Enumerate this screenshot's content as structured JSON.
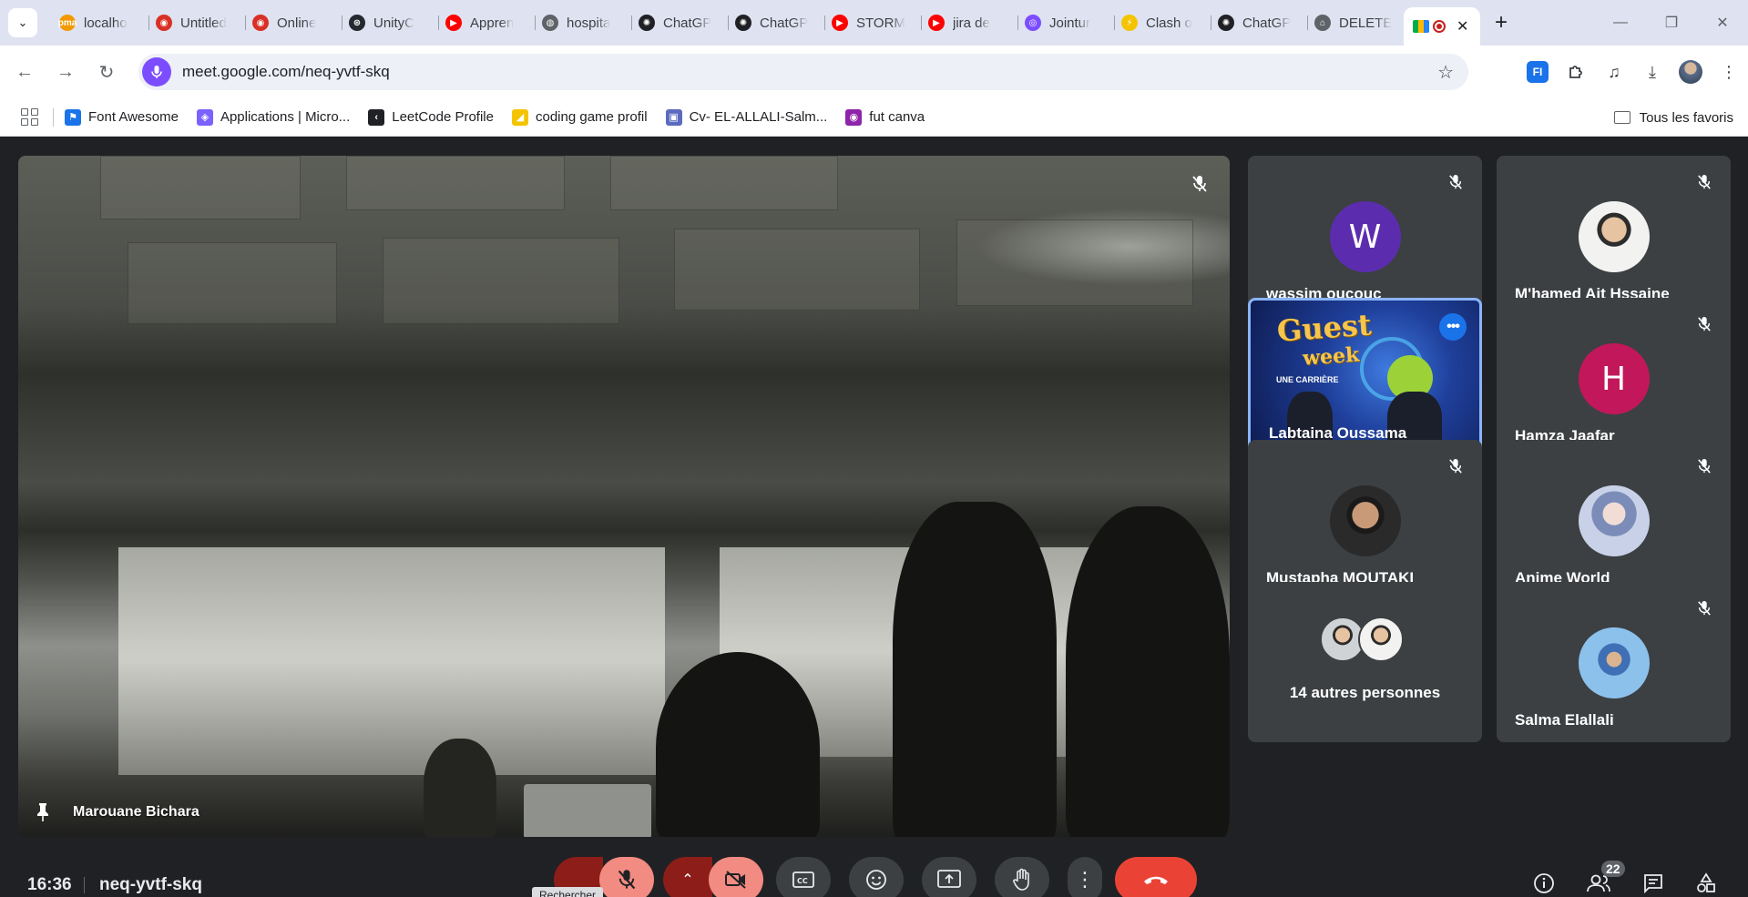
{
  "browser": {
    "tabs": [
      {
        "title": "localho",
        "fav_color": "#f29900",
        "fav_glyph": "pma"
      },
      {
        "title": "Untitled",
        "fav_color": "#d93025",
        "fav_glyph": "◉"
      },
      {
        "title": "Online",
        "fav_color": "#d93025",
        "fav_glyph": "◉"
      },
      {
        "title": "UnityC",
        "fav_color": "#24292f",
        "fav_glyph": "⊛"
      },
      {
        "title": "Appren",
        "fav_color": "#ff0000",
        "fav_glyph": "▶"
      },
      {
        "title": "hospita",
        "fav_color": "#5f6368",
        "fav_glyph": "◍"
      },
      {
        "title": "ChatGP",
        "fav_color": "#202124",
        "fav_glyph": "✺"
      },
      {
        "title": "ChatGP",
        "fav_color": "#202124",
        "fav_glyph": "✺"
      },
      {
        "title": "STORM",
        "fav_color": "#ff0000",
        "fav_glyph": "▶"
      },
      {
        "title": "jira de",
        "fav_color": "#ff0000",
        "fav_glyph": "▶"
      },
      {
        "title": "Jointur",
        "fav_color": "#7c4dff",
        "fav_glyph": "◎"
      },
      {
        "title": "Clash o",
        "fav_color": "#f5c400",
        "fav_glyph": "⚡"
      },
      {
        "title": "ChatGP",
        "fav_color": "#202124",
        "fav_glyph": "✺"
      },
      {
        "title": "DELETE",
        "fav_color": "#5f6368",
        "fav_glyph": "⌂"
      }
    ],
    "active_tab": {
      "title": "",
      "icon": "google-meet-icon"
    },
    "url": "meet.google.com/neq-yvtf-skq",
    "extension_label": "FI",
    "bookmarks": [
      {
        "label": "Font Awesome",
        "color": "#1a73e8",
        "glyph": "⚑"
      },
      {
        "label": "Applications | Micro...",
        "color": "#7b61ff",
        "glyph": "◈"
      },
      {
        "label": "LeetCode Profile",
        "color": "#202124",
        "glyph": "‹"
      },
      {
        "label": "coding game profil",
        "color": "#f5c400",
        "glyph": "◢"
      },
      {
        "label": "Cv- EL-ALLALI-Salm...",
        "color": "#5c6bc0",
        "glyph": "▣"
      },
      {
        "label": "fut canva",
        "color": "#8e24aa",
        "glyph": "◉"
      }
    ],
    "all_bookmarks_label": "Tous les favoris"
  },
  "meet": {
    "main_speaker": {
      "name": "Marouane Bichara",
      "muted": true,
      "pinned": true
    },
    "tiles": [
      {
        "name": "wassim oucouc",
        "initial": "W",
        "avatar_color": "#5b2dae",
        "muted": true
      },
      {
        "name": "M'hamed Ait Hssaine",
        "initial": "",
        "avatar_color": "photo",
        "muted": true
      },
      {
        "name": "Labtaina Oussama",
        "initial": "",
        "avatar_color": "video",
        "muted": false,
        "speaking": true
      },
      {
        "name": "Hamza Jaafar",
        "initial": "H",
        "avatar_color": "#c2185b",
        "muted": true
      },
      {
        "name": "Mustapha MOUTAKI",
        "initial": "",
        "avatar_color": "photo",
        "muted": true
      },
      {
        "name": "Anime World",
        "initial": "",
        "avatar_color": "photo",
        "muted": true
      },
      {
        "name": "14 autres personnes",
        "initial": "",
        "avatar_color": "group",
        "muted": false
      },
      {
        "name": "Salma Elallali",
        "initial": "",
        "avatar_color": "photo",
        "muted": true
      }
    ],
    "poster": {
      "title_line1": "Guest",
      "title_line2": "week",
      "subtitle": "UNE CARRIÈRE"
    },
    "bottom": {
      "time": "16:36",
      "meeting_code": "neq-yvtf-skq",
      "tooltip": "Rechercher",
      "participant_count": "22"
    }
  }
}
